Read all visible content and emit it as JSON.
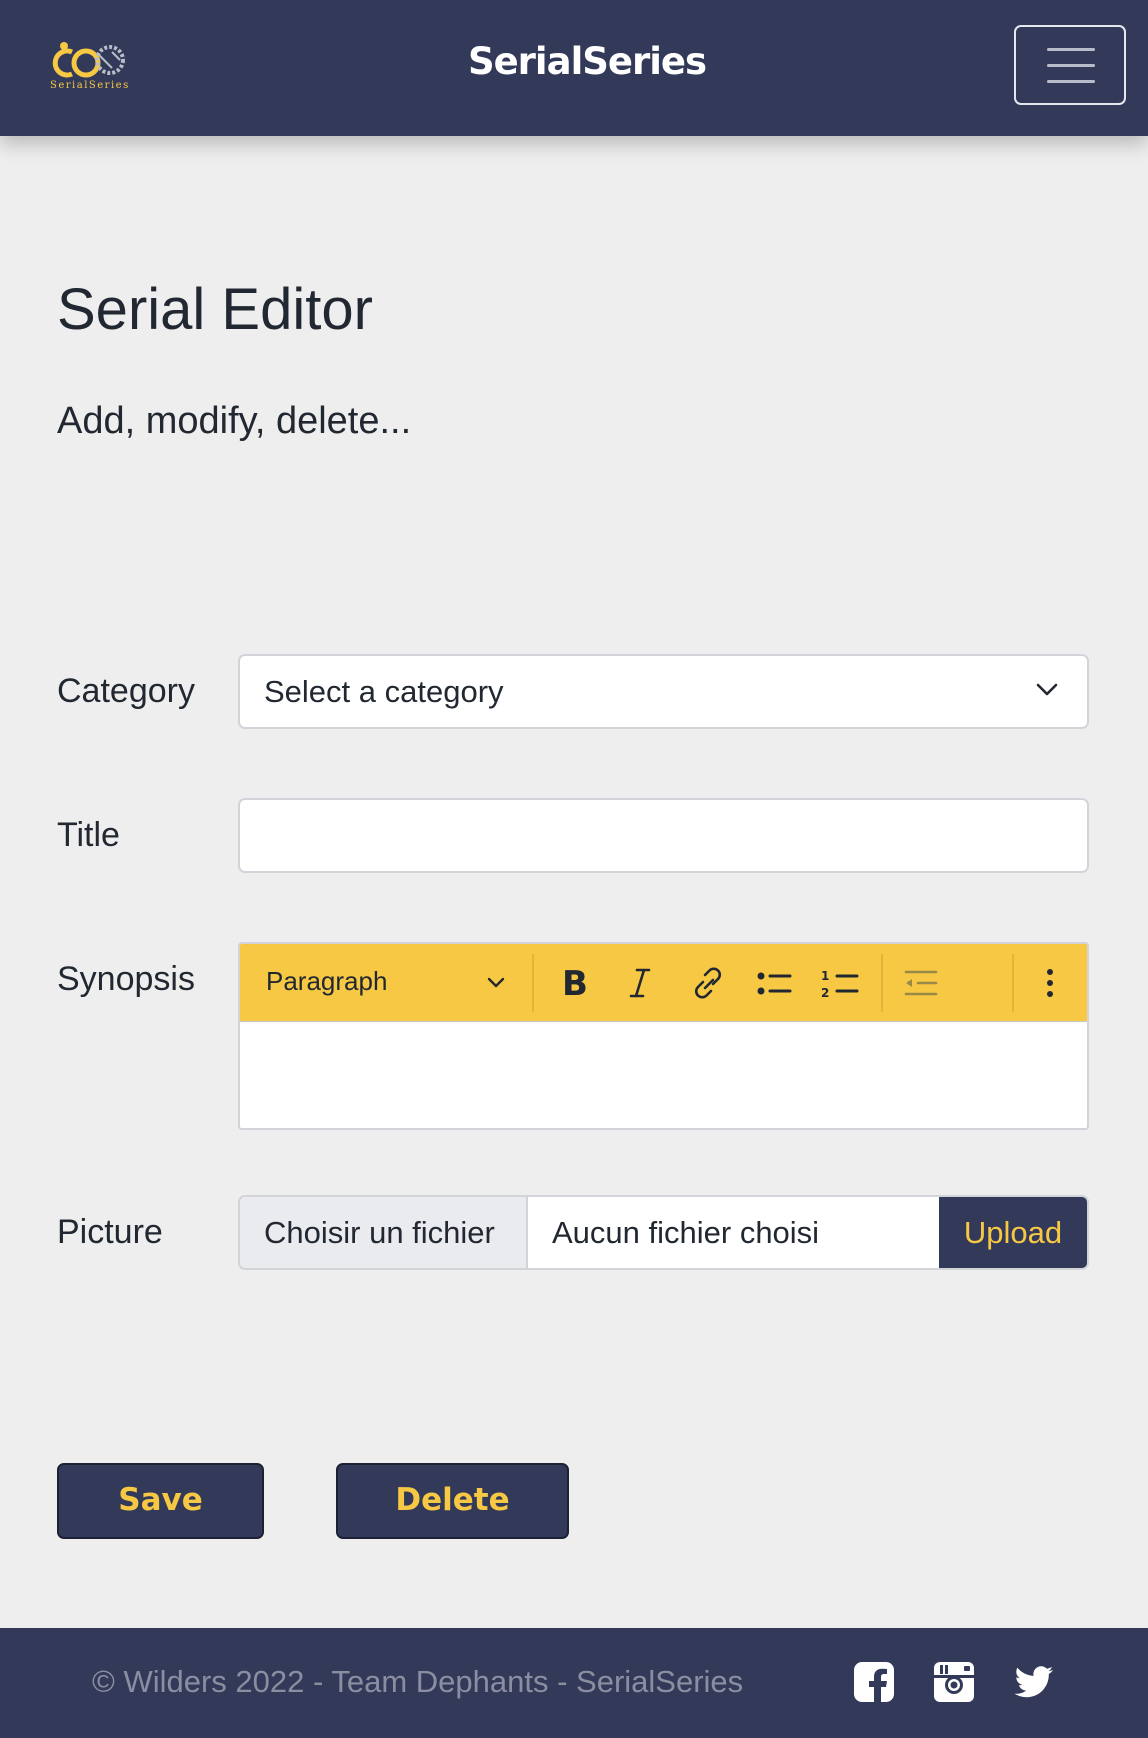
{
  "navbar": {
    "brand": "SerialSeries",
    "logo_text": "SerialSeries",
    "menu_icon": "hamburger-icon"
  },
  "main": {
    "title": "Serial Editor",
    "subtitle": "Add, modify, delete..."
  },
  "form": {
    "category": {
      "label": "Category",
      "value": "Select a category"
    },
    "title": {
      "label": "Title",
      "value": ""
    },
    "synopsis": {
      "label": "Synopsis",
      "toolbar": {
        "heading": "Paragraph",
        "buttons": [
          "bold-icon",
          "italic-icon",
          "link-icon",
          "bulleted-list-icon",
          "numbered-list-icon",
          "outdent-icon",
          "more-icon"
        ]
      },
      "content": ""
    },
    "picture": {
      "label": "Picture",
      "choose_label": "Choisir un fichier",
      "file_status": "Aucun fichier choisi",
      "upload_label": "Upload"
    }
  },
  "actions": {
    "save": "Save",
    "delete": "Delete"
  },
  "footer": {
    "copyright": "© Wilders 2022 - Team Dephants - SerialSeries",
    "social": [
      "facebook-icon",
      "instagram-icon",
      "twitter-icon"
    ]
  },
  "colors": {
    "primary": "#333a59",
    "accent": "#f7c843",
    "background": "#eeeeee"
  }
}
